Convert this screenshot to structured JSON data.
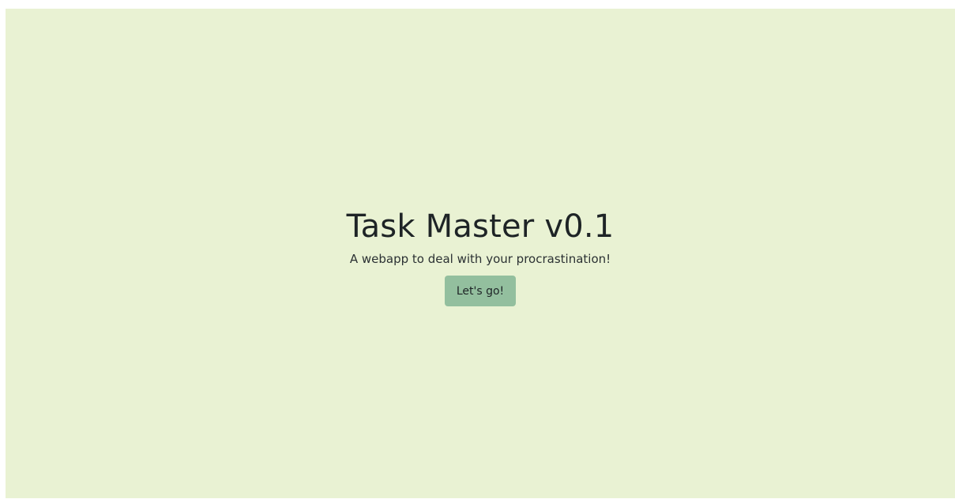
{
  "hero": {
    "title": "Task Master v0.1",
    "subtitle": "A webapp to deal with your procrastination!",
    "cta_label": "Let's go!"
  },
  "colors": {
    "background": "#e9f2d3",
    "button": "#93bf9e",
    "text": "#1e2426"
  }
}
